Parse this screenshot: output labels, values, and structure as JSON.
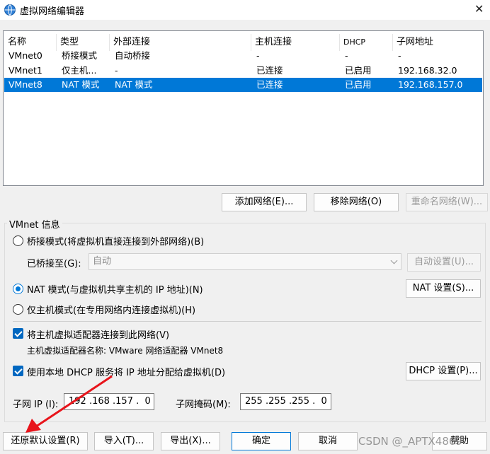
{
  "window": {
    "title": "虚拟网络编辑器",
    "close_glyph": "✕"
  },
  "list": {
    "headers": [
      "名称",
      "类型",
      "外部连接",
      "主机连接",
      "DHCP",
      "子网地址"
    ],
    "rows": [
      [
        "VMnet0",
        "桥接模式",
        "自动桥接",
        "-",
        "-",
        "-"
      ],
      [
        "VMnet1",
        "仅主机...",
        "-",
        "已连接",
        "已启用",
        "192.168.32.0"
      ],
      [
        "VMnet8",
        "NAT 模式",
        "NAT 模式",
        "已连接",
        "已启用",
        "192.168.157.0"
      ]
    ],
    "selected_index": 2
  },
  "list_buttons": {
    "add": "添加网络(E)...",
    "remove": "移除网络(O)",
    "rename": "重命名网络(W)..."
  },
  "vmnet_info": {
    "group_label": "VMnet 信息",
    "bridged_label": "桥接模式(将虚拟机直接连接到外部网络)(B)",
    "bridged_to_label": "已桥接至(G):",
    "bridged_to_value": "自动",
    "auto_settings": "自动设置(U)...",
    "nat_label": "NAT 模式(与虚拟机共享主机的 IP 地址)(N)",
    "nat_settings": "NAT 设置(S)...",
    "hostonly_label": "仅主机模式(在专用网络内连接虚拟机)(H)",
    "selected_mode": "nat",
    "connect_adapter_label": "将主机虚拟适配器连接到此网络(V)",
    "adapter_name_line": "主机虚拟适配器名称: VMware 网络适配器 VMnet8",
    "use_dhcp_label": "使用本地 DHCP 服务将 IP 地址分配给虚拟机(D)",
    "dhcp_settings": "DHCP 设置(P)...",
    "subnet_ip_label": "子网 IP (I):",
    "subnet_ip_value": "192 .168 .157 .  0",
    "subnet_mask_label": "子网掩码(M):",
    "subnet_mask_value": "255 .255 .255 .  0"
  },
  "bottom_buttons": {
    "restore": "还原默认设置(R)",
    "import": "导入(T)...",
    "export": "导出(X)...",
    "ok": "确定",
    "cancel": "取消",
    "help": "帮助"
  },
  "colors": {
    "selection": "#0078d7",
    "annotation_arrow": "#e8141b"
  },
  "watermark": "CSDN @_APTX4869"
}
